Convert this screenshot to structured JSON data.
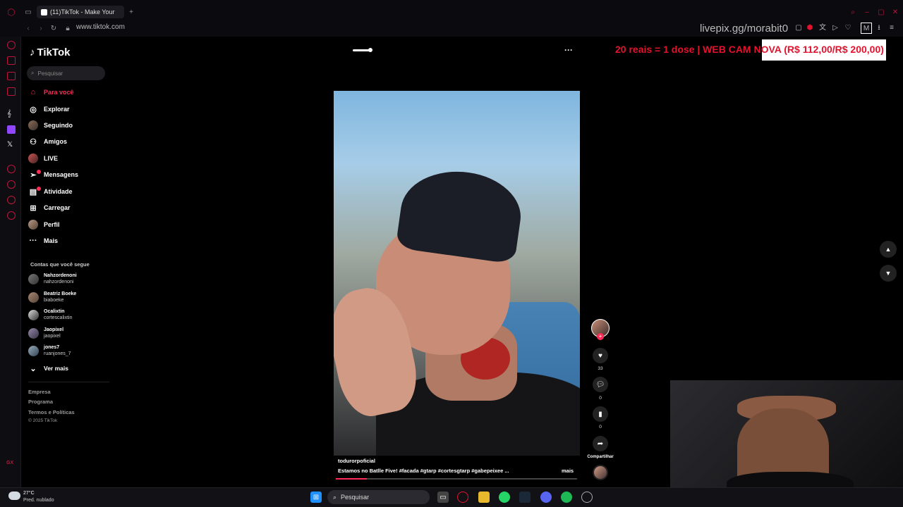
{
  "browser": {
    "tab_title": "(11)TikTok - Make Your",
    "url": "www.tiktok.com",
    "overlay_text": "livepix.gg/morabit0"
  },
  "tiktok": {
    "logo": "TikTok",
    "search_placeholder": "Pesquisar",
    "nav": [
      {
        "label": "Para você",
        "icon": "home-icon"
      },
      {
        "label": "Explorar",
        "icon": "compass-icon"
      },
      {
        "label": "Seguindo",
        "icon": "following-icon"
      },
      {
        "label": "Amigos",
        "icon": "friends-icon"
      },
      {
        "label": "LIVE",
        "icon": "live-icon"
      },
      {
        "label": "Mensagens",
        "icon": "messages-icon"
      },
      {
        "label": "Atividade",
        "icon": "activity-icon"
      },
      {
        "label": "Carregar",
        "icon": "upload-icon"
      },
      {
        "label": "Perfil",
        "icon": "profile-icon"
      },
      {
        "label": "Mais",
        "icon": "more-icon"
      }
    ],
    "following_title": "Contas que você segue",
    "following": [
      {
        "name": "Nahzordenoni",
        "user": "nahzordenoni"
      },
      {
        "name": "Beatriz Boeke",
        "user": "biaboeke"
      },
      {
        "name": "Ocalixtin",
        "user": "cortescalixtin"
      },
      {
        "name": "Jaopixel",
        "user": "jaopixel"
      },
      {
        "name": "jones7",
        "user": "ruanjones_7"
      }
    ],
    "see_more": "Ver mais",
    "footer": [
      "Empresa",
      "Programa",
      "Termos e Políticas",
      "© 2025 TikTok"
    ],
    "video": {
      "username": "todurorpoficial",
      "caption": "Estamos no Batlle Five! #facada #gtarp #cortesgtarp #gabepeixee ...",
      "more": "mais",
      "progress": 0.13,
      "likes": "33",
      "comments": "0",
      "saves": "0",
      "share_label": "Compartilhar"
    }
  },
  "stream_overlay": {
    "banner": "20 reais = 1 dose | WEB CAM NOVA (R$ 112,00/R$ 200,00)"
  },
  "taskbar": {
    "temp": "27°C",
    "weather": "Pred. nublado",
    "search": "Pesquisar"
  }
}
